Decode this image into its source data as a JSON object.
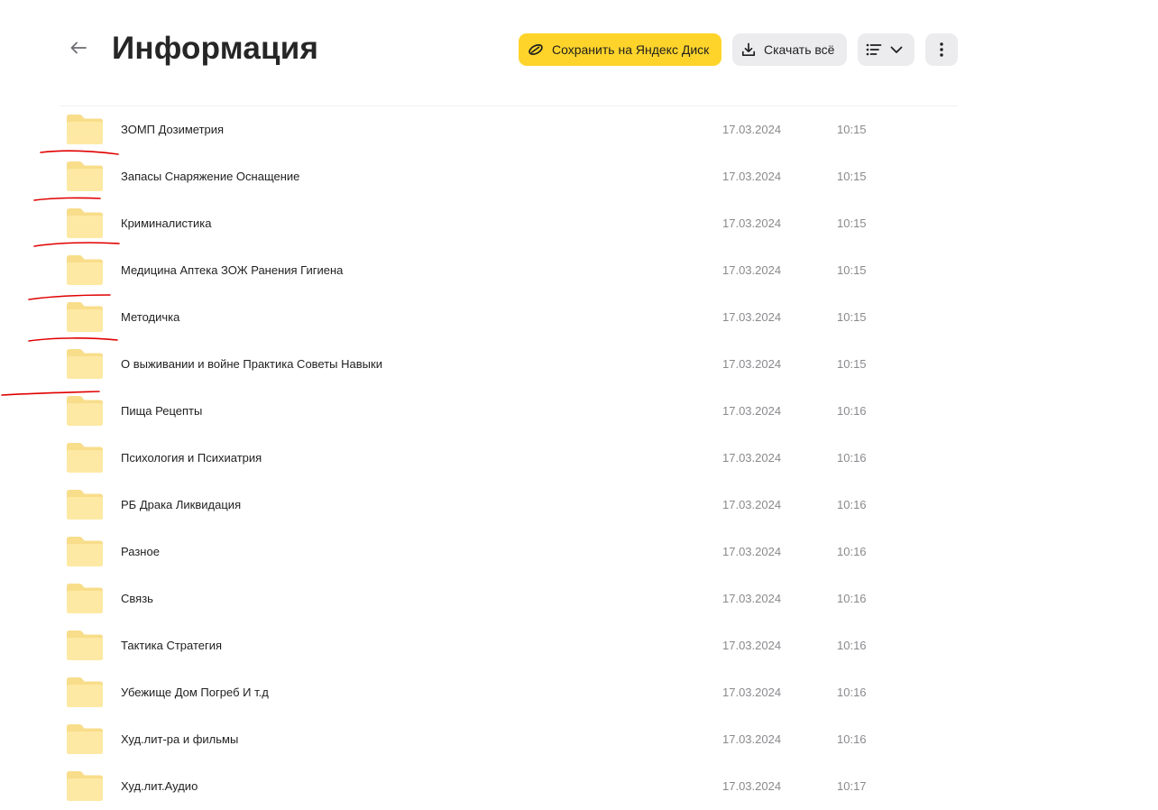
{
  "header": {
    "title": "Информация",
    "save_label": "Сохранить на Яндекс Диск",
    "download_label": "Скачать всё",
    "brand_color": "#fed42b"
  },
  "icons": {
    "back": "arrow-left-icon",
    "save": "yandex-disk-icon",
    "download": "download-icon",
    "view": "list-view-icon",
    "more": "more-vertical-icon",
    "folder": "folder-icon"
  },
  "folders": [
    {
      "name": "ЗОМП Дозиметрия",
      "date": "17.03.2024",
      "time": "10:15"
    },
    {
      "name": "Запасы Снаряжение Оснащение",
      "date": "17.03.2024",
      "time": "10:15"
    },
    {
      "name": "Криминалистика",
      "date": "17.03.2024",
      "time": "10:15"
    },
    {
      "name": "Медицина Аптека ЗОЖ Ранения Гигиена",
      "date": "17.03.2024",
      "time": "10:15"
    },
    {
      "name": "Методичка",
      "date": "17.03.2024",
      "time": "10:15"
    },
    {
      "name": "О выживании и войне Практика Советы Навыки",
      "date": "17.03.2024",
      "time": "10:15"
    },
    {
      "name": "Пища Рецепты",
      "date": "17.03.2024",
      "time": "10:16"
    },
    {
      "name": "Психология и Психиатрия",
      "date": "17.03.2024",
      "time": "10:16"
    },
    {
      "name": "РБ Драка Ликвидация",
      "date": "17.03.2024",
      "time": "10:16"
    },
    {
      "name": "Разное",
      "date": "17.03.2024",
      "time": "10:16"
    },
    {
      "name": "Связь",
      "date": "17.03.2024",
      "time": "10:16"
    },
    {
      "name": "Тактика Стратегия",
      "date": "17.03.2024",
      "time": "10:16"
    },
    {
      "name": "Убежище Дом Погреб И т.д",
      "date": "17.03.2024",
      "time": "10:16"
    },
    {
      "name": "Худ.лит-ра и фильмы",
      "date": "17.03.2024",
      "time": "10:16"
    },
    {
      "name": "Худ.лит.Аудио",
      "date": "17.03.2024",
      "time": "10:17"
    }
  ],
  "annotation": {
    "color": "#e00000",
    "style": "red-underline-marks"
  }
}
